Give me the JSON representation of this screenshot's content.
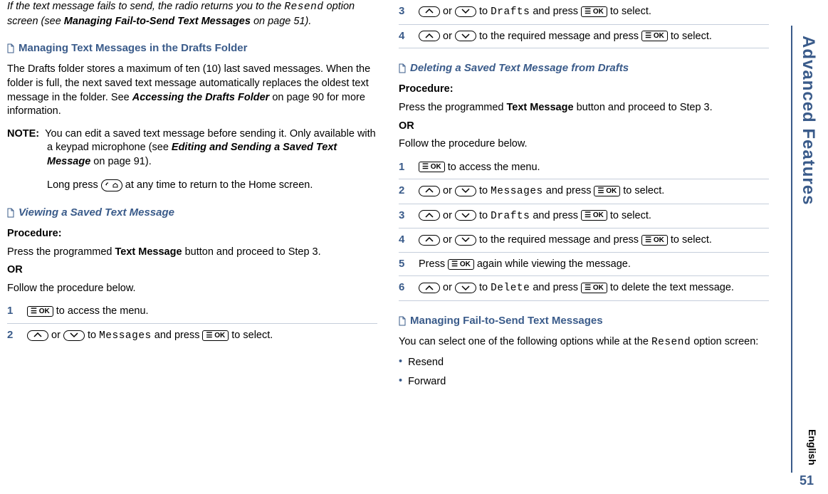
{
  "sideTab": "Advanced Features",
  "englishLabel": "English",
  "pageNum": "51",
  "col1": {
    "intro1_a": "If the text message fails to send, the radio returns you to the ",
    "intro1_resend": "Resend",
    "intro1_b": " option screen (see ",
    "intro1_bold": "Managing Fail-to-Send Text Messages",
    "intro1_c": " on page 51).",
    "head1": "Managing Text Messages in the Drafts Folder",
    "para1_a": "The Drafts folder stores a maximum of ten (10) last saved messages. When the folder is full, the next saved text message automatically replaces the oldest text message in the folder. See ",
    "para1_bold": "Accessing the Drafts Folder",
    "para1_b": " on page 90 for more information.",
    "noteLabel": "NOTE:",
    "note1_a": "You can edit a saved text message before sending it. Only available with a keypad microphone (see ",
    "note1_bold": "Editing and Sending a Saved Text Message",
    "note1_b": " on page 91).",
    "note2_a": "Long press ",
    "note2_b": " at any time to return to the Home screen.",
    "head2": "Viewing a Saved Text Message",
    "procLabel": "Procedure:",
    "proc1_a": "Press the programmed ",
    "proc1_bold": "Text Message",
    "proc1_b": " button and proceed to Step 3.",
    "or": "OR",
    "proc2": "Follow the procedure below.",
    "step1": " to access the menu.",
    "step2_a": " or ",
    "step2_b": " to ",
    "step2_code": "Messages",
    "step2_c": " and press ",
    "step2_d": " to select."
  },
  "col2": {
    "step3_a": " or ",
    "step3_b": " to ",
    "step3_code": "Drafts",
    "step3_c": " and press ",
    "step3_d": " to select.",
    "step4_a": " or ",
    "step4_b": " to the required message and press ",
    "step4_c": " to select.",
    "head3": "Deleting a Saved Text Message from Drafts",
    "procLabel": "Procedure:",
    "proc1_a": "Press the programmed ",
    "proc1_bold": "Text Message",
    "proc1_b": " button and proceed to Step 3.",
    "or": "OR",
    "proc2": "Follow the procedure below.",
    "b_step1": " to access the menu.",
    "b_step2_a": " or ",
    "b_step2_b": " to ",
    "b_step2_code": "Messages",
    "b_step2_c": " and press ",
    "b_step2_d": " to select.",
    "b_step3_a": " or ",
    "b_step3_b": " to ",
    "b_step3_code": "Drafts",
    "b_step3_c": " and press ",
    "b_step3_d": " to select.",
    "b_step4_a": " or ",
    "b_step4_b": " to the required message and press ",
    "b_step4_c": " to select.",
    "b_step5_a": "Press ",
    "b_step5_b": " again while viewing the message.",
    "b_step6_a": " or ",
    "b_step6_b": " to ",
    "b_step6_code": "Delete",
    "b_step6_c": " and press ",
    "b_step6_d": " to delete the text message.",
    "head4": "Managing Fail-to-Send Text Messages",
    "para4_a": "You can select one of the following options while at the ",
    "para4_code": "Resend",
    "para4_b": " option screen:",
    "bullet1": "Resend",
    "bullet2": "Forward"
  },
  "keys": {
    "ok": "OK",
    "menu": "☰"
  },
  "nums": {
    "n1": "1",
    "n2": "2",
    "n3": "3",
    "n4": "4",
    "n5": "5",
    "n6": "6"
  }
}
